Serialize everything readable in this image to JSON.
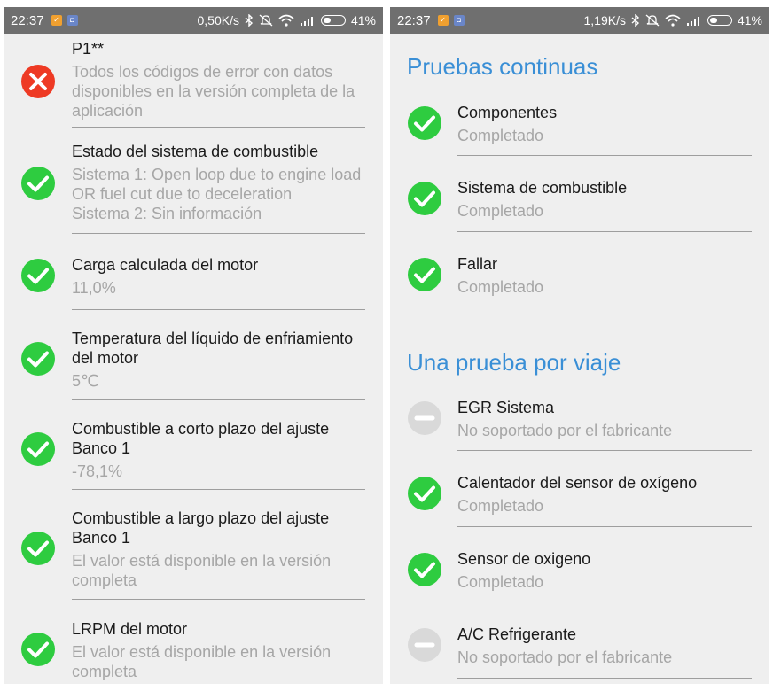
{
  "statusbar_left": {
    "time": "22:37",
    "network_speed": "0,50K/s",
    "battery": "41%"
  },
  "statusbar_right": {
    "time": "22:37",
    "network_speed": "1,19K/s",
    "battery": "41%"
  },
  "left_items": [
    {
      "title": "P1**",
      "value": "Todos los códigos de error con datos disponibles en la versión completa de la aplicación",
      "status": "error"
    },
    {
      "title": "Estado del sistema de combustible",
      "value": "Sistema 1: Open loop due to engine load OR fuel cut due to deceleration\nSistema 2: Sin información",
      "status": "ok"
    },
    {
      "title": "Carga calculada del motor",
      "value": "11,0%",
      "status": "ok"
    },
    {
      "title": "Temperatura del líquido de enfriamiento del motor",
      "value": "5℃",
      "status": "ok"
    },
    {
      "title": "Combustible a corto plazo del ajuste Banco 1",
      "value": "-78,1%",
      "status": "ok"
    },
    {
      "title": "Combustible a largo plazo del ajuste Banco 1",
      "value": "El valor está disponible en la versión completa",
      "status": "ok"
    },
    {
      "title": "LRPM del motor",
      "value": "El valor está disponible en la versión completa",
      "status": "ok"
    }
  ],
  "continuous_header": "Pruebas continuas",
  "continuous_items": [
    {
      "title": "Componentes",
      "value": "Completado",
      "status": "ok"
    },
    {
      "title": "Sistema de combustible",
      "value": "Completado",
      "status": "ok"
    },
    {
      "title": "Fallar",
      "value": "Completado",
      "status": "ok"
    }
  ],
  "per_trip_header": "Una prueba por viaje",
  "per_trip_items": [
    {
      "title": "EGR Sistema",
      "value": "No soportado por el fabricante",
      "status": "unsupported"
    },
    {
      "title": "Calentador del sensor de oxígeno",
      "value": "Completado",
      "status": "ok"
    },
    {
      "title": "Sensor de oxigeno",
      "value": "Completado",
      "status": "ok"
    },
    {
      "title": "A/C Refrigerante",
      "value": "No soportado por el fabricante",
      "status": "unsupported"
    }
  ],
  "colors": {
    "ok": "#2ecc40",
    "error": "#ee3a24",
    "unsupported": "#d9d9d9",
    "header": "#3a8fd6"
  },
  "icons": {
    "ok": "check-circle-icon",
    "error": "x-circle-icon",
    "unsupported": "minus-circle-icon"
  }
}
